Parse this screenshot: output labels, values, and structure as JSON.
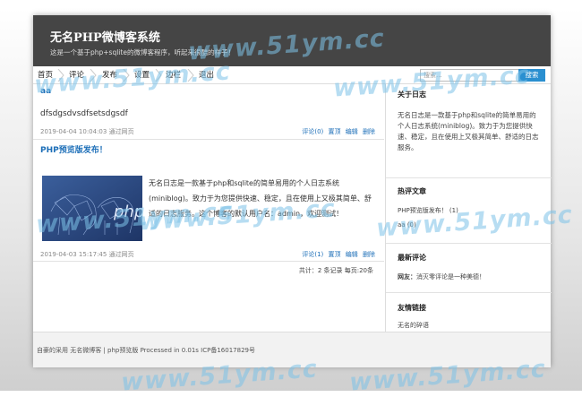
{
  "header": {
    "title": "无名PHP微博客系统",
    "subtitle": "这是一个基于php+sqlite的微博客程序，听起来很酷的样子！"
  },
  "nav": {
    "items": [
      "首页",
      "评论",
      "发布",
      "设置",
      "边栏",
      "退出"
    ],
    "search_placeholder": "搜索...",
    "search_button": "搜索"
  },
  "posts": [
    {
      "title": "aa",
      "body": "dfsdgsdvsdfsetsdgsdf",
      "meta": "2019-04-04 10:04:03 通过网页",
      "actions": [
        "评论(0)",
        "置顶",
        "编辑",
        "删除"
      ]
    },
    {
      "title": "PHP预览版发布！",
      "excerpt": "无名日志是一款基于php和sqlite的简单易用的个人日志系统(miniblog)。致力于为您提供快速、稳定，且在使用上又极其简单、舒适的日志服务。这个博客的默认用户名：admin，欢迎测试！",
      "meta": "2019-04-03 15:17:45 通过网页",
      "actions": [
        "评论(1)",
        "置顶",
        "编辑",
        "删除"
      ],
      "thumb_text": "php"
    }
  ],
  "pager": "共计：2 条记录 每页:20条",
  "sidebar": {
    "about_title": "关于日志",
    "about_text": "无名日志是一款基于php和sqlite的简单易用的个人日志系统(miniblog)。致力于为您提供快速、稳定，且在使用上又极其简单、舒适的日志服务。",
    "hot_title": "热评文章",
    "hot_items": [
      "PHP预览版发布！ (1)",
      "aa (0)"
    ],
    "comments_title": "最新评论",
    "comment_user": "网友：",
    "comment_text": "消灭零评论是一种美德！",
    "links_title": "友情链接",
    "links_items": [
      "无名的碎语"
    ]
  },
  "footer": {
    "text": "自豪的采用 无名微博客 | php预览版 Processed in 0.01s ICP备16017829号"
  },
  "watermark": "www.51ym.cc",
  "colors": {
    "header_bg": "#454545",
    "accent": "#1d6fb8",
    "search_btn": "#2a8fd0"
  }
}
